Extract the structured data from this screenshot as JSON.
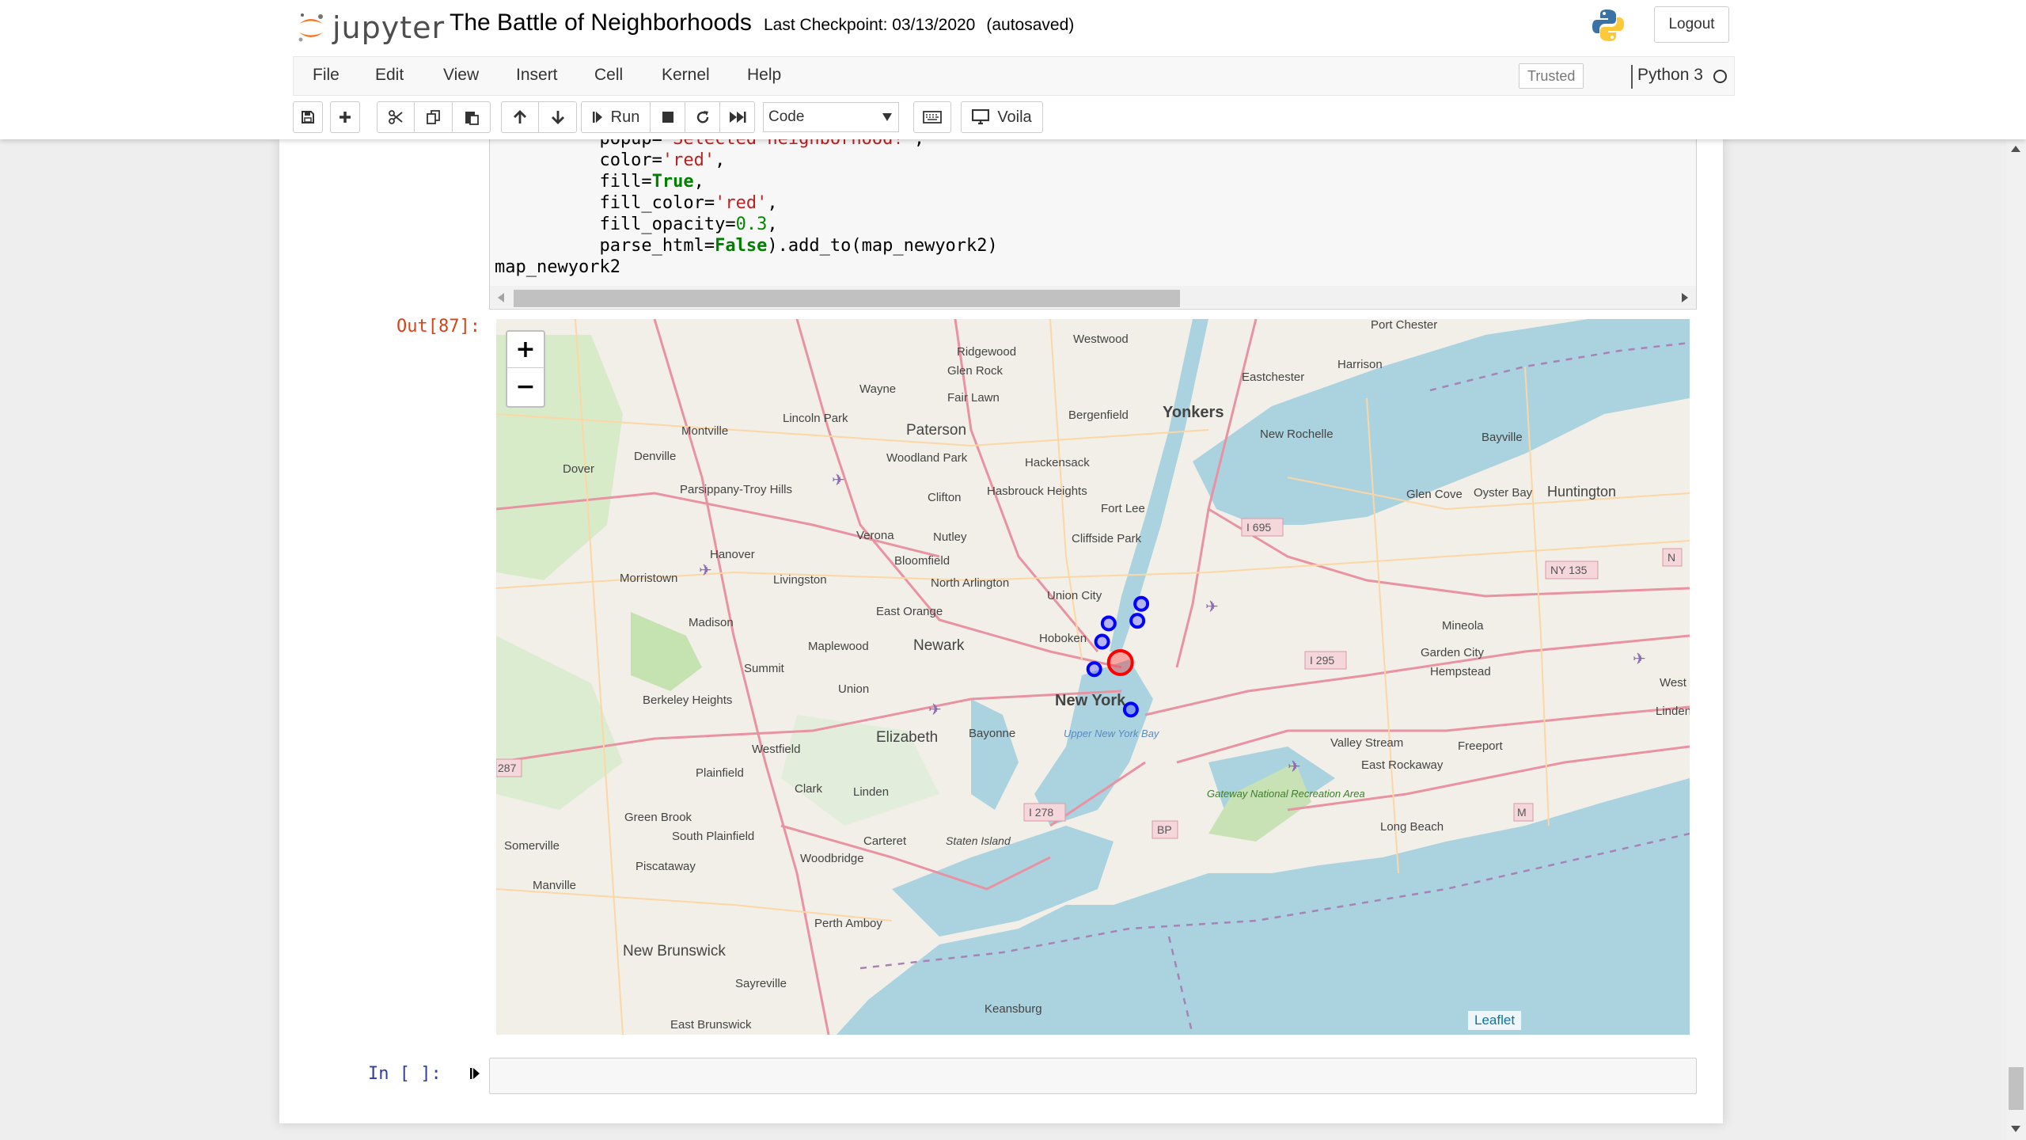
{
  "header": {
    "logo_text": "jupyter",
    "notebook_title": "The Battle of Neighborhoods",
    "checkpoint": "Last Checkpoint: 03/13/2020",
    "autosave_status": "(autosaved)",
    "logout_label": "Logout"
  },
  "menu": {
    "items": [
      "File",
      "Edit",
      "View",
      "Insert",
      "Cell",
      "Kernel",
      "Help"
    ],
    "trusted_label": "Trusted",
    "kernel_name": "Python 3"
  },
  "toolbar": {
    "run_label": "Run",
    "cell_type": "Code",
    "voila_label": "Voila",
    "icons": [
      "save-icon",
      "plus-icon",
      "cut-icon",
      "copy-icon",
      "paste-icon",
      "arrow-up-icon",
      "arrow-down-icon",
      "run-icon",
      "stop-icon",
      "restart-icon",
      "fast-forward-icon",
      "keyboard-icon",
      "desktop-icon"
    ]
  },
  "code_cell": {
    "lines": [
      "          popup='Selected neighborhood!',",
      "          color='red',",
      "          fill=True,",
      "          fill_color='red',",
      "          fill_opacity=0.3,",
      "          parse_html=False).add_to(map_newyork2)",
      "map_newyork2"
    ]
  },
  "output": {
    "prompt": "Out[87]:",
    "map": {
      "zoom_in": "+",
      "zoom_out": "−",
      "attribution": "Leaflet",
      "marker_colors": {
        "neighborhood": "#0000ff",
        "selected": "#ff0000"
      },
      "place_labels": [
        "Port Chester",
        "Westwood",
        "Ridgewood",
        "Glen Rock",
        "Harrison",
        "Eastchester",
        "Wayne",
        "Fair Lawn",
        "Bergenfield",
        "Yonkers",
        "Lincoln Park",
        "Montville",
        "Paterson",
        "New Rochelle",
        "Bayville",
        "Denville",
        "Dover",
        "Woodland Park",
        "Hackensack",
        "Parsippany-Troy Hills",
        "Clifton",
        "Hasbrouck Heights",
        "Fort Lee",
        "Glen Cove",
        "Oyster Bay",
        "Huntington",
        "Verona",
        "Nutley",
        "Cliffside Park",
        "Hanover",
        "Bloomfield",
        "Morristown",
        "Livingston",
        "North Arlington",
        "Union City",
        "East Orange",
        "Madison",
        "Newark",
        "Hoboken",
        "New York",
        "Mineola",
        "Maplewood",
        "Summit",
        "Garden City",
        "Hempstead",
        "Union",
        "Berkeley Heights",
        "Elizabeth",
        "Bayonne",
        "Westfield",
        "Upper New York Bay",
        "Valley Stream",
        "Freeport",
        "Plainfield",
        "Clark",
        "Linden",
        "East Rockaway",
        "Green Brook",
        "Gateway National Recreation Area",
        "South Plainfield",
        "Carteret",
        "Staten Island",
        "Long Beach",
        "Somerville",
        "Piscataway",
        "Woodbridge",
        "Manville",
        "Perth Amboy",
        "New Brunswick",
        "Sayreville",
        "Keansburg",
        "East Brunswick",
        "West",
        "Lindenh"
      ],
      "shields": [
        "I 695",
        "NY 135",
        "I 295",
        "I 278",
        "BP",
        "M",
        "N",
        "287"
      ]
    }
  },
  "next_cell": {
    "prompt": "In [ ]:"
  }
}
